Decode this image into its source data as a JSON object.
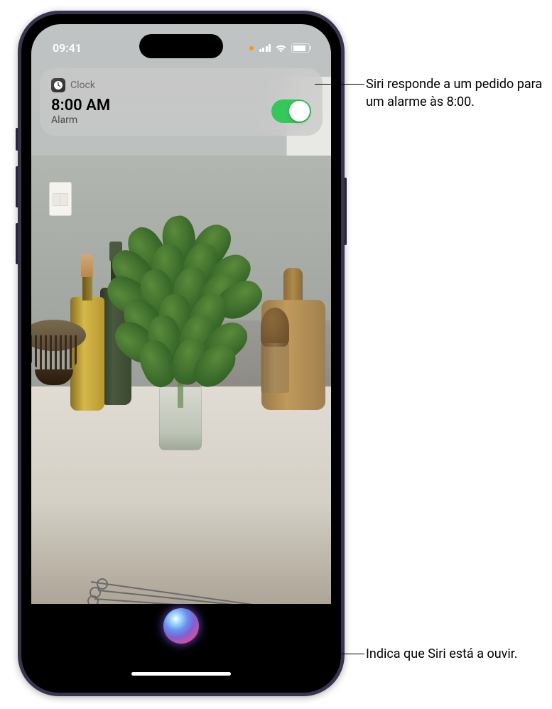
{
  "status": {
    "time": "09:41"
  },
  "notification": {
    "app": "Clock",
    "time": "8:00 AM",
    "label": "Alarm",
    "toggle_on": true
  },
  "callouts": {
    "top": "Siri responde a um pedido para um alarme às 8:00.",
    "bottom": "Indica que Siri está a ouvir."
  }
}
